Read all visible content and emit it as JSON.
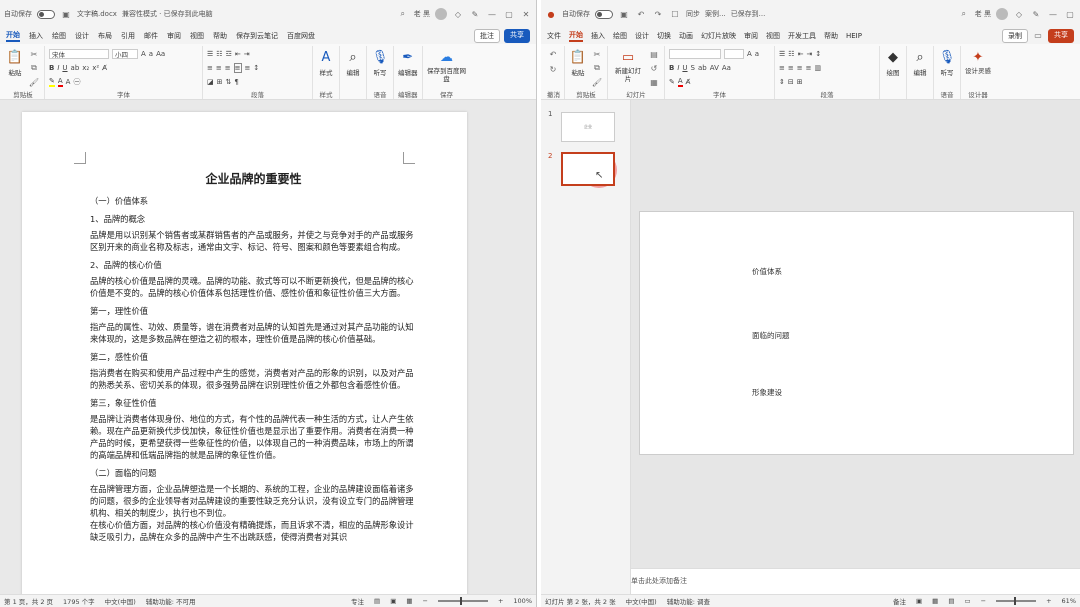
{
  "word": {
    "title": {
      "autosave": "自动保存",
      "autosave_state": "关",
      "filename": "文字稿.docx",
      "compat": "兼容性模式 · 已保存到此电脑",
      "user": "老 黑"
    },
    "tabs": [
      "开始",
      "插入",
      "绘图",
      "设计",
      "布局",
      "引用",
      "邮件",
      "审阅",
      "视图",
      "帮助",
      "保存到云笔记",
      "百度网盘"
    ],
    "active_tab": "开始",
    "comments_button": "批注",
    "share_button": "共享",
    "ribbon": {
      "paste": "粘贴",
      "clipboard_label": "剪贴板",
      "font_name": "宋体",
      "font_size": "小四",
      "font_label": "字体",
      "paragraph_label": "段落",
      "styles_btn": "样式",
      "styles_label": "样式",
      "editing_btn": "编辑",
      "dictate_btn": "听写",
      "voice_label": "语音",
      "editor_btn": "编辑器",
      "editor_label": "编辑器",
      "save_btn": "保存到百度网盘",
      "save_label": "保存"
    },
    "doc": {
      "title": "企业品牌的重要性",
      "blocks": [
        {
          "t": "h",
          "text": "（一）价值体系"
        },
        {
          "t": "h",
          "text": "1、品牌的概念"
        },
        {
          "t": "p",
          "text": "品牌是用以识别某个销售者或某群销售者的产品或服务，并使之与竞争对手的产品或服务区别开来的商业名称及标志，通常由文字、标记、符号、图案和颜色等要素组合构成。"
        },
        {
          "t": "h",
          "text": "2、品牌的核心价值"
        },
        {
          "t": "p",
          "text": "品牌的核心价值是品牌的灵魂。品牌的功能、款式等可以不断更新换代，但是品牌的核心价值是不变的。品牌的核心价值体系包括理性价值、感性价值和象征性价值三大方面。"
        },
        {
          "t": "h",
          "text": "第一，理性价值"
        },
        {
          "t": "p",
          "text": "指产品的属性、功效、质量等，谱在消费者对品牌的认知首先是通过对其产品功能的认知来体现的，这是多数品牌在塑造之初的根本，理性价值是品牌的核心价值基础。"
        },
        {
          "t": "h",
          "text": "第二，感性价值"
        },
        {
          "t": "p",
          "text": "指消费者在购买和使用产品过程中产生的感觉，消费者对产品的形象的识别，以及对产品的熟悉关系、密切关系的体现，很多强势品牌在识别理性价值之外都包含着感性价值。"
        },
        {
          "t": "h",
          "text": "第三，象征性价值"
        },
        {
          "t": "p",
          "text": "是品牌让消费者体现身份、地位的方式，有个性的品牌代表一种生活的方式，让人产生依赖。现在产品更新换代步伐加快，象征性价值也是显示出了重要作用。消费者在消费一种产品的时候，更希望获得一些象征性的价值，以体现自己的一种消费品味，市场上的所谓的高端品牌和低端品牌指的就是品牌的象征性价值。"
        },
        {
          "t": "h",
          "text": "（二）面临的问题"
        },
        {
          "t": "p",
          "text": "在品牌管理方面，企业品牌塑造是一个长期的、系统的工程，企业的品牌建设面临着诸多的问题，很多的企业领导者对品牌建设的重要性缺乏充分认识，没有设立专门的品牌管理机构、相关的制度少，执行也不到位。"
        },
        {
          "t": "p",
          "text": "在核心价值方面，对品牌的核心价值没有精确提炼，而且诉求不清，相应的品牌形象设计缺乏吸引力，品牌在众多的品牌中产生不出跳跃感，使得消费者对其识"
        }
      ]
    },
    "status": {
      "page": "第 1 页，共 2 页",
      "words": "1795 个字",
      "lang": "中文(中国)",
      "access": "辅助功能: 不可用",
      "focus": "专注",
      "zoom": "100%"
    }
  },
  "ppt": {
    "title": {
      "autosave": "自动保存",
      "autosave_state": "关",
      "sync": "同步",
      "filename": "案例...",
      "saved": "已保存到...",
      "user": "老 黑"
    },
    "tabs": [
      "文件",
      "开始",
      "插入",
      "绘图",
      "设计",
      "切换",
      "动画",
      "幻灯片放映",
      "审阅",
      "视图",
      "开发工具",
      "帮助",
      "HEIP"
    ],
    "active_tab": "开始",
    "record_button": "录制",
    "share_button": "共享",
    "ribbon": {
      "undo_label": "撤消",
      "paste": "粘贴",
      "clipboard_label": "剪贴板",
      "new_slide": "新建幻灯片",
      "slides_label": "幻灯片",
      "font_label": "字体",
      "paragraph_label": "段落",
      "drawing_btn": "绘图",
      "editing_btn": "编辑",
      "dictate_btn": "听写",
      "voice_label": "语音",
      "designer_btn": "设计灵感",
      "designer_label": "设计器"
    },
    "thumbnails": [
      {
        "num": "1",
        "caption": "企业"
      },
      {
        "num": "2",
        "caption": ""
      }
    ],
    "slide_items": [
      "价值体系",
      "面临的问题",
      "形象建设"
    ],
    "notes_placeholder": "单击此处添加备注",
    "status": {
      "slide": "幻灯片 第 2 张，共 2 张",
      "lang": "中文(中国)",
      "access": "辅助功能: 调查",
      "notes": "备注",
      "zoom": "61%"
    }
  }
}
